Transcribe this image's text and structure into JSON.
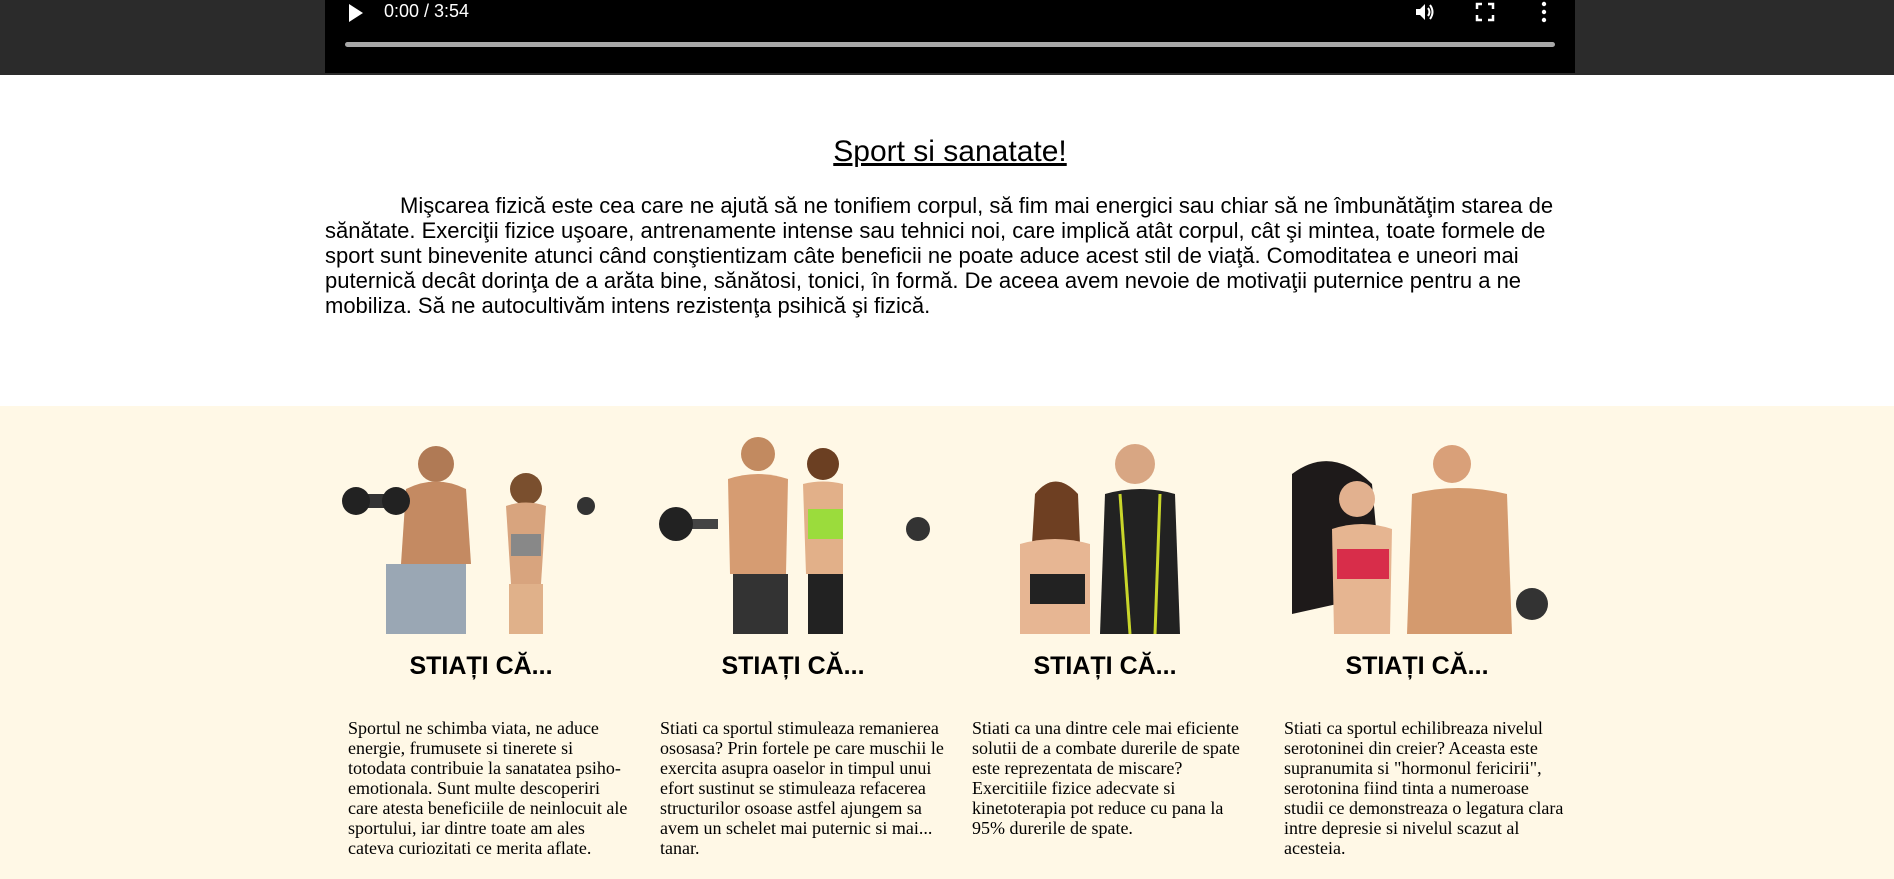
{
  "video": {
    "time": "0:00 / 3:54",
    "progress_fraction": 0,
    "icons": [
      "play-icon",
      "volume-icon",
      "fullscreen-icon",
      "more-options-icon"
    ]
  },
  "intro": {
    "title": "Sport si sanatate!",
    "paragraph": "Mişcarea fizică este cea care ne ajută să ne tonifiem corpul, să fim mai energici sau chiar să ne îmbunătăţim starea de sănătate. Exerciţii fizice uşoare, antrenamente intense sau tehnici noi, care implică atât corpul, cât şi mintea, toate formele de sport sunt binevenite atunci când conştientizam câte beneficii ne poate aduce acest stil de viaţă. Comoditatea e uneori mai puternică decât dorinţa de a arăta bine, sănătosi, tonici, în formă. De aceea avem nevoie de motivaţii puternice pentru a ne mobiliza. Să ne autocultivăm intens rezistenţa psihică şi fizică."
  },
  "colors": {
    "cards_background": "#fff8e6",
    "video_background": "#000000",
    "top_band": "#2b2b2b"
  },
  "cards": [
    {
      "heading": "STIAȚI CĂ...",
      "text": "Sportul ne schimba viata, ne aduce energie, frumusete si tinerete si totodata contribuie la sanatatea psiho-emotionala. Sunt multe descoperiri care atesta beneficiile de neinlocuit ale sportului, iar dintre toate am ales cateva curiozitati ce merita aflate."
    },
    {
      "heading": "STIAȚI CĂ...",
      "text": "Stiati ca sportul stimuleaza remanierea ososasa? Prin fortele pe care muschii le exercita asupra oaselor in timpul unui efort sustinut se stimuleaza refacerea structurilor osoase astfel ajungem sa avem un schelet mai puternic si mai... tanar."
    },
    {
      "heading": "STIAȚI CĂ...",
      "text": "Stiati ca una dintre cele mai eficiente solutii de a combate durerile de spate este reprezentata de miscare? Exercitiile fizice adecvate si kinetoterapia pot reduce cu pana la 95% durerile de spate."
    },
    {
      "heading": "STIAȚI CĂ...",
      "text": "Stiati ca sportul echilibreaza nivelul serotoninei din creier? Aceasta este supranumita si \"hormonul fericirii\", serotonina fiind tinta a numeroase studii ce demonstreaza o legatura clara intre depresie si nivelul scazut al acesteia."
    }
  ]
}
